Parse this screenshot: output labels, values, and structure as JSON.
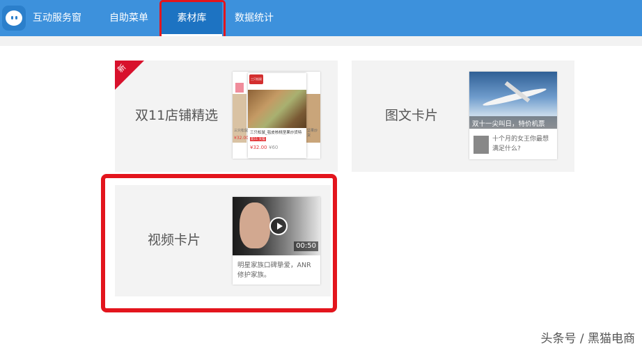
{
  "header": {
    "app_name": "互动服务窗",
    "nav": [
      {
        "label": "自助菜单"
      },
      {
        "label": "素材库",
        "active": true
      },
      {
        "label": "数据统计"
      }
    ],
    "brand_color": "#3d91dc",
    "active_color": "#1d73c2"
  },
  "materials": {
    "cards": [
      {
        "title": "双11店铺精选",
        "badge": "新",
        "preview": {
          "logo_text": "三只松鼠",
          "product_title": "三只松鼠_毯皮核桃坚果炒货特",
          "tag": "双11 天猫",
          "price": "¥32.00",
          "orig_price": "¥60",
          "side_left": "三只松鼠",
          "side_right": "坚果炒货",
          "side_price": "¥32.00"
        }
      },
      {
        "title": "图文卡片",
        "preview": {
          "caption": "双十一尖叫日，特价机票",
          "text": "十个月的女王你最想满足什么?"
        }
      },
      {
        "title": "视频卡片",
        "preview": {
          "duration": "00:50",
          "text": "明星家族口碑挚爱，ANR修护家族。"
        }
      }
    ]
  },
  "watermark": "头条号 / 黑猫电商",
  "annotation_color": "#e3151d"
}
